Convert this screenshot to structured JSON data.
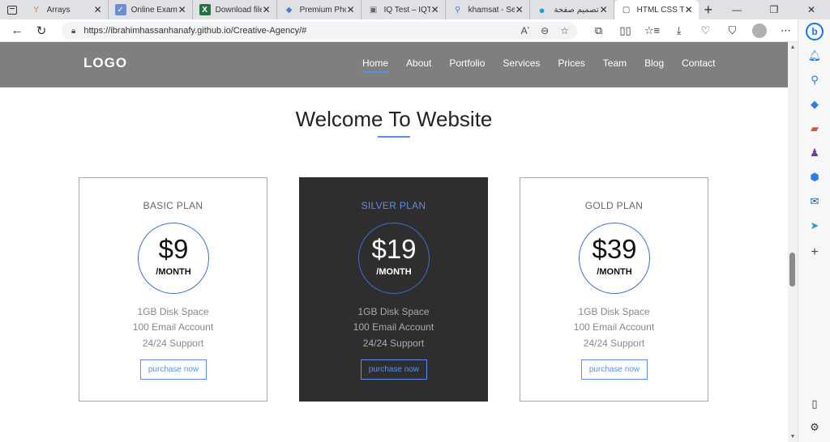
{
  "browser": {
    "tabs": [
      {
        "title": "Arrays",
        "favicon": "Y",
        "color": "#c28b3c"
      },
      {
        "title": "Online Exam S",
        "favicon": "✓",
        "color": "#6a8fd0"
      },
      {
        "title": "Download file",
        "favicon": "X",
        "color": "#217346"
      },
      {
        "title": "Premium Pho",
        "favicon": "◆",
        "color": "#4a7bd0"
      },
      {
        "title": "IQ Test – IQTe",
        "favicon": "▣",
        "color": "#666666"
      },
      {
        "title": "khamsat - Sea",
        "favicon": "⚲",
        "color": "#4a7bd0"
      },
      {
        "title": "تصميم صفحة",
        "favicon": "●",
        "color": "#1a9fdb"
      },
      {
        "title": "HTML CSS Te",
        "favicon": "▢",
        "color": "#444444"
      }
    ],
    "url": "https://ibrahimhassanhanafy.github.io/Creative-Agency/#"
  },
  "site": {
    "logo": "LOGO",
    "nav": [
      "Home",
      "About",
      "Portfolio",
      "Services",
      "Prices",
      "Team",
      "Blog",
      "Contact"
    ],
    "active_nav": "Home",
    "section_title": "Welcome To Website",
    "accent_color": "#5b8def",
    "plans": [
      {
        "name": "BASIC PLAN",
        "price": "$9",
        "period": "/MONTH",
        "features": [
          "1GB Disk Space",
          "100 Email Account",
          "24/24 Support"
        ],
        "button": "purchase now"
      },
      {
        "name": "SILVER PLAN",
        "price": "$19",
        "period": "/MONTH",
        "features": [
          "1GB Disk Space",
          "100 Email Account",
          "24/24 Support"
        ],
        "button": "purchase now"
      },
      {
        "name": "GOLD PLAN",
        "price": "$39",
        "period": "/MONTH",
        "features": [
          "1GB Disk Space",
          "100 Email Account",
          "24/24 Support"
        ],
        "button": "purchase now"
      }
    ]
  }
}
